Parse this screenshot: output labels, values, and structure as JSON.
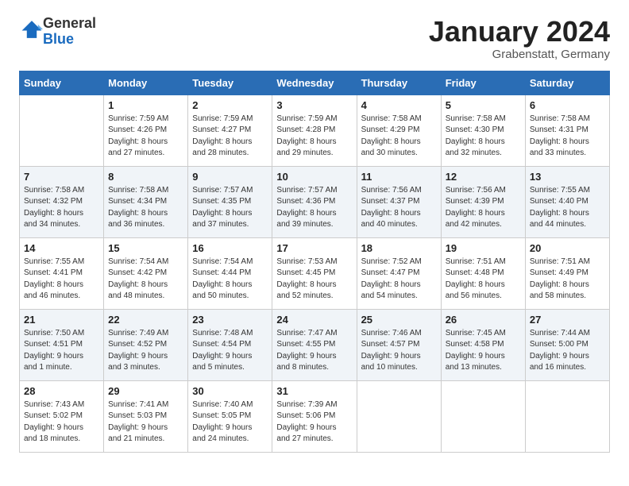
{
  "header": {
    "logo_general": "General",
    "logo_blue": "Blue",
    "month_title": "January 2024",
    "location": "Grabenstatt, Germany"
  },
  "days_of_week": [
    "Sunday",
    "Monday",
    "Tuesday",
    "Wednesday",
    "Thursday",
    "Friday",
    "Saturday"
  ],
  "weeks": [
    [
      {
        "day": "",
        "text": ""
      },
      {
        "day": "1",
        "text": "Sunrise: 7:59 AM\nSunset: 4:26 PM\nDaylight: 8 hours\nand 27 minutes."
      },
      {
        "day": "2",
        "text": "Sunrise: 7:59 AM\nSunset: 4:27 PM\nDaylight: 8 hours\nand 28 minutes."
      },
      {
        "day": "3",
        "text": "Sunrise: 7:59 AM\nSunset: 4:28 PM\nDaylight: 8 hours\nand 29 minutes."
      },
      {
        "day": "4",
        "text": "Sunrise: 7:58 AM\nSunset: 4:29 PM\nDaylight: 8 hours\nand 30 minutes."
      },
      {
        "day": "5",
        "text": "Sunrise: 7:58 AM\nSunset: 4:30 PM\nDaylight: 8 hours\nand 32 minutes."
      },
      {
        "day": "6",
        "text": "Sunrise: 7:58 AM\nSunset: 4:31 PM\nDaylight: 8 hours\nand 33 minutes."
      }
    ],
    [
      {
        "day": "7",
        "text": "Sunrise: 7:58 AM\nSunset: 4:32 PM\nDaylight: 8 hours\nand 34 minutes."
      },
      {
        "day": "8",
        "text": "Sunrise: 7:58 AM\nSunset: 4:34 PM\nDaylight: 8 hours\nand 36 minutes."
      },
      {
        "day": "9",
        "text": "Sunrise: 7:57 AM\nSunset: 4:35 PM\nDaylight: 8 hours\nand 37 minutes."
      },
      {
        "day": "10",
        "text": "Sunrise: 7:57 AM\nSunset: 4:36 PM\nDaylight: 8 hours\nand 39 minutes."
      },
      {
        "day": "11",
        "text": "Sunrise: 7:56 AM\nSunset: 4:37 PM\nDaylight: 8 hours\nand 40 minutes."
      },
      {
        "day": "12",
        "text": "Sunrise: 7:56 AM\nSunset: 4:39 PM\nDaylight: 8 hours\nand 42 minutes."
      },
      {
        "day": "13",
        "text": "Sunrise: 7:55 AM\nSunset: 4:40 PM\nDaylight: 8 hours\nand 44 minutes."
      }
    ],
    [
      {
        "day": "14",
        "text": "Sunrise: 7:55 AM\nSunset: 4:41 PM\nDaylight: 8 hours\nand 46 minutes."
      },
      {
        "day": "15",
        "text": "Sunrise: 7:54 AM\nSunset: 4:42 PM\nDaylight: 8 hours\nand 48 minutes."
      },
      {
        "day": "16",
        "text": "Sunrise: 7:54 AM\nSunset: 4:44 PM\nDaylight: 8 hours\nand 50 minutes."
      },
      {
        "day": "17",
        "text": "Sunrise: 7:53 AM\nSunset: 4:45 PM\nDaylight: 8 hours\nand 52 minutes."
      },
      {
        "day": "18",
        "text": "Sunrise: 7:52 AM\nSunset: 4:47 PM\nDaylight: 8 hours\nand 54 minutes."
      },
      {
        "day": "19",
        "text": "Sunrise: 7:51 AM\nSunset: 4:48 PM\nDaylight: 8 hours\nand 56 minutes."
      },
      {
        "day": "20",
        "text": "Sunrise: 7:51 AM\nSunset: 4:49 PM\nDaylight: 8 hours\nand 58 minutes."
      }
    ],
    [
      {
        "day": "21",
        "text": "Sunrise: 7:50 AM\nSunset: 4:51 PM\nDaylight: 9 hours\nand 1 minute."
      },
      {
        "day": "22",
        "text": "Sunrise: 7:49 AM\nSunset: 4:52 PM\nDaylight: 9 hours\nand 3 minutes."
      },
      {
        "day": "23",
        "text": "Sunrise: 7:48 AM\nSunset: 4:54 PM\nDaylight: 9 hours\nand 5 minutes."
      },
      {
        "day": "24",
        "text": "Sunrise: 7:47 AM\nSunset: 4:55 PM\nDaylight: 9 hours\nand 8 minutes."
      },
      {
        "day": "25",
        "text": "Sunrise: 7:46 AM\nSunset: 4:57 PM\nDaylight: 9 hours\nand 10 minutes."
      },
      {
        "day": "26",
        "text": "Sunrise: 7:45 AM\nSunset: 4:58 PM\nDaylight: 9 hours\nand 13 minutes."
      },
      {
        "day": "27",
        "text": "Sunrise: 7:44 AM\nSunset: 5:00 PM\nDaylight: 9 hours\nand 16 minutes."
      }
    ],
    [
      {
        "day": "28",
        "text": "Sunrise: 7:43 AM\nSunset: 5:02 PM\nDaylight: 9 hours\nand 18 minutes."
      },
      {
        "day": "29",
        "text": "Sunrise: 7:41 AM\nSunset: 5:03 PM\nDaylight: 9 hours\nand 21 minutes."
      },
      {
        "day": "30",
        "text": "Sunrise: 7:40 AM\nSunset: 5:05 PM\nDaylight: 9 hours\nand 24 minutes."
      },
      {
        "day": "31",
        "text": "Sunrise: 7:39 AM\nSunset: 5:06 PM\nDaylight: 9 hours\nand 27 minutes."
      },
      {
        "day": "",
        "text": ""
      },
      {
        "day": "",
        "text": ""
      },
      {
        "day": "",
        "text": ""
      }
    ]
  ]
}
